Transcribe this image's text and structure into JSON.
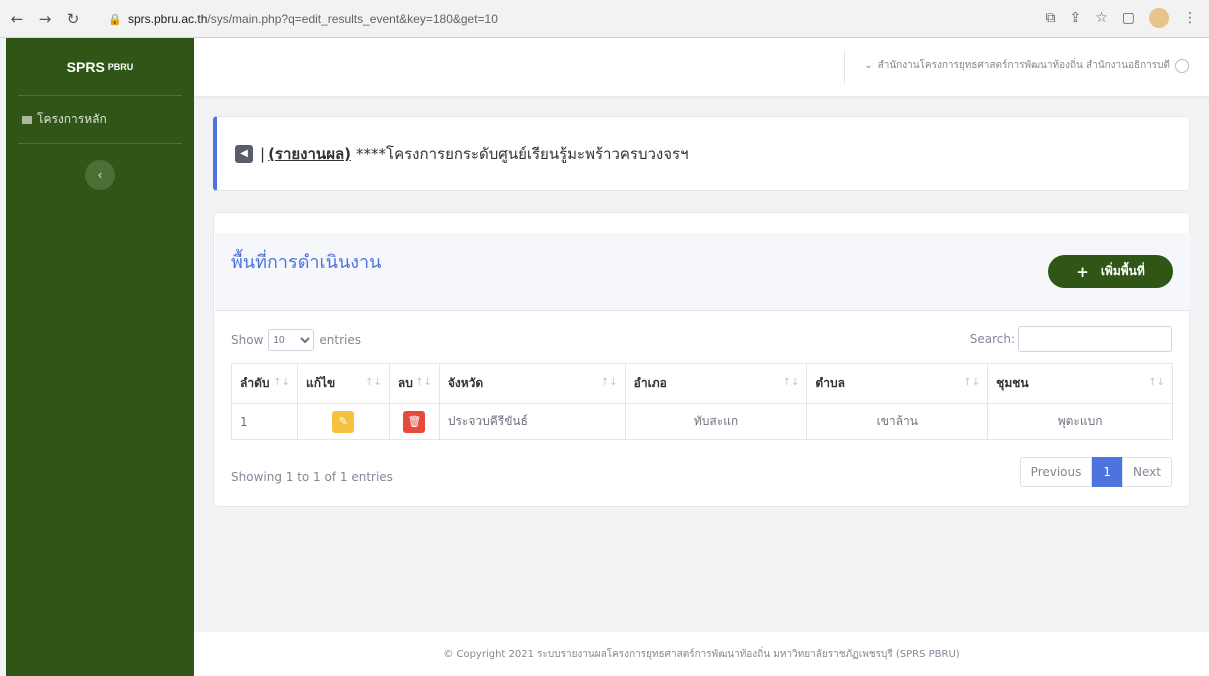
{
  "browser": {
    "url_host": "sprs.pbru.ac.th",
    "url_path": "/sys/main.php?q=edit_results_event&key=180&get=10"
  },
  "sidebar": {
    "brand": "SPRS",
    "brand_sup": "PBRU",
    "items": [
      {
        "label": "โครงการหลัก",
        "icon": "book-icon"
      }
    ]
  },
  "topbar": {
    "user_name": "สำนักงานโครงการยุทธศาสตร์การพัฒนาท้องถิ่น สำนักงานอธิการบดี"
  },
  "title_card": {
    "separator": "|",
    "link_label": "(รายงานผล)",
    "project_title": "****โครงการยกระดับศูนย์เรียนรู้มะพร้าวครบวงจรฯ"
  },
  "main_card": {
    "heading": "พื้นที่การดำเนินงาน",
    "add_button": "เพิ่มพื้นที่"
  },
  "table_controls": {
    "show_label": "Show",
    "entries_label": "entries",
    "length_value": "10",
    "search_label": "Search:"
  },
  "table": {
    "headers": [
      "ลำดับ",
      "แก้ไข",
      "ลบ",
      "จังหวัด",
      "อำเภอ",
      "ตำบล",
      "ชุมชน"
    ],
    "rows": [
      {
        "index": "1",
        "province": "ประจวบคีรีขันธ์",
        "district": "ทับสะแก",
        "subdistrict": "เขาล้าน",
        "community": "พุตะแบก"
      }
    ]
  },
  "pagination": {
    "info": "Showing 1 to 1 of 1 entries",
    "previous": "Previous",
    "current": "1",
    "next": "Next"
  },
  "footer": {
    "text": "© Copyright 2021 ระบบรายงานผลโครงการยุทธศาสตร์การพัฒนาท้องถิ่น มหาวิทยาลัยราชภัฏเพชรบุรี (SPRS PBRU)"
  },
  "colors": {
    "sidebar": "#2f5616",
    "accent": "#4e73df",
    "edit": "#f6c23e",
    "delete": "#e74a3b"
  }
}
